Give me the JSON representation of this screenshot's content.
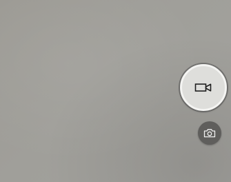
{
  "app": {
    "name": "Camera",
    "mode": "video"
  },
  "controls": {
    "record_button": {
      "icon": "video-camera-icon",
      "state": "idle"
    },
    "photo_button": {
      "icon": "camera-icon"
    }
  },
  "colors": {
    "viewfinder": "#a09f9a",
    "record_button_fill": "#dededb",
    "record_button_ring": "#f4f4f2",
    "photo_button_fill": "#5f5e5c",
    "icon_dark": "#1e1e1e",
    "icon_light": "#f2f2f2"
  }
}
